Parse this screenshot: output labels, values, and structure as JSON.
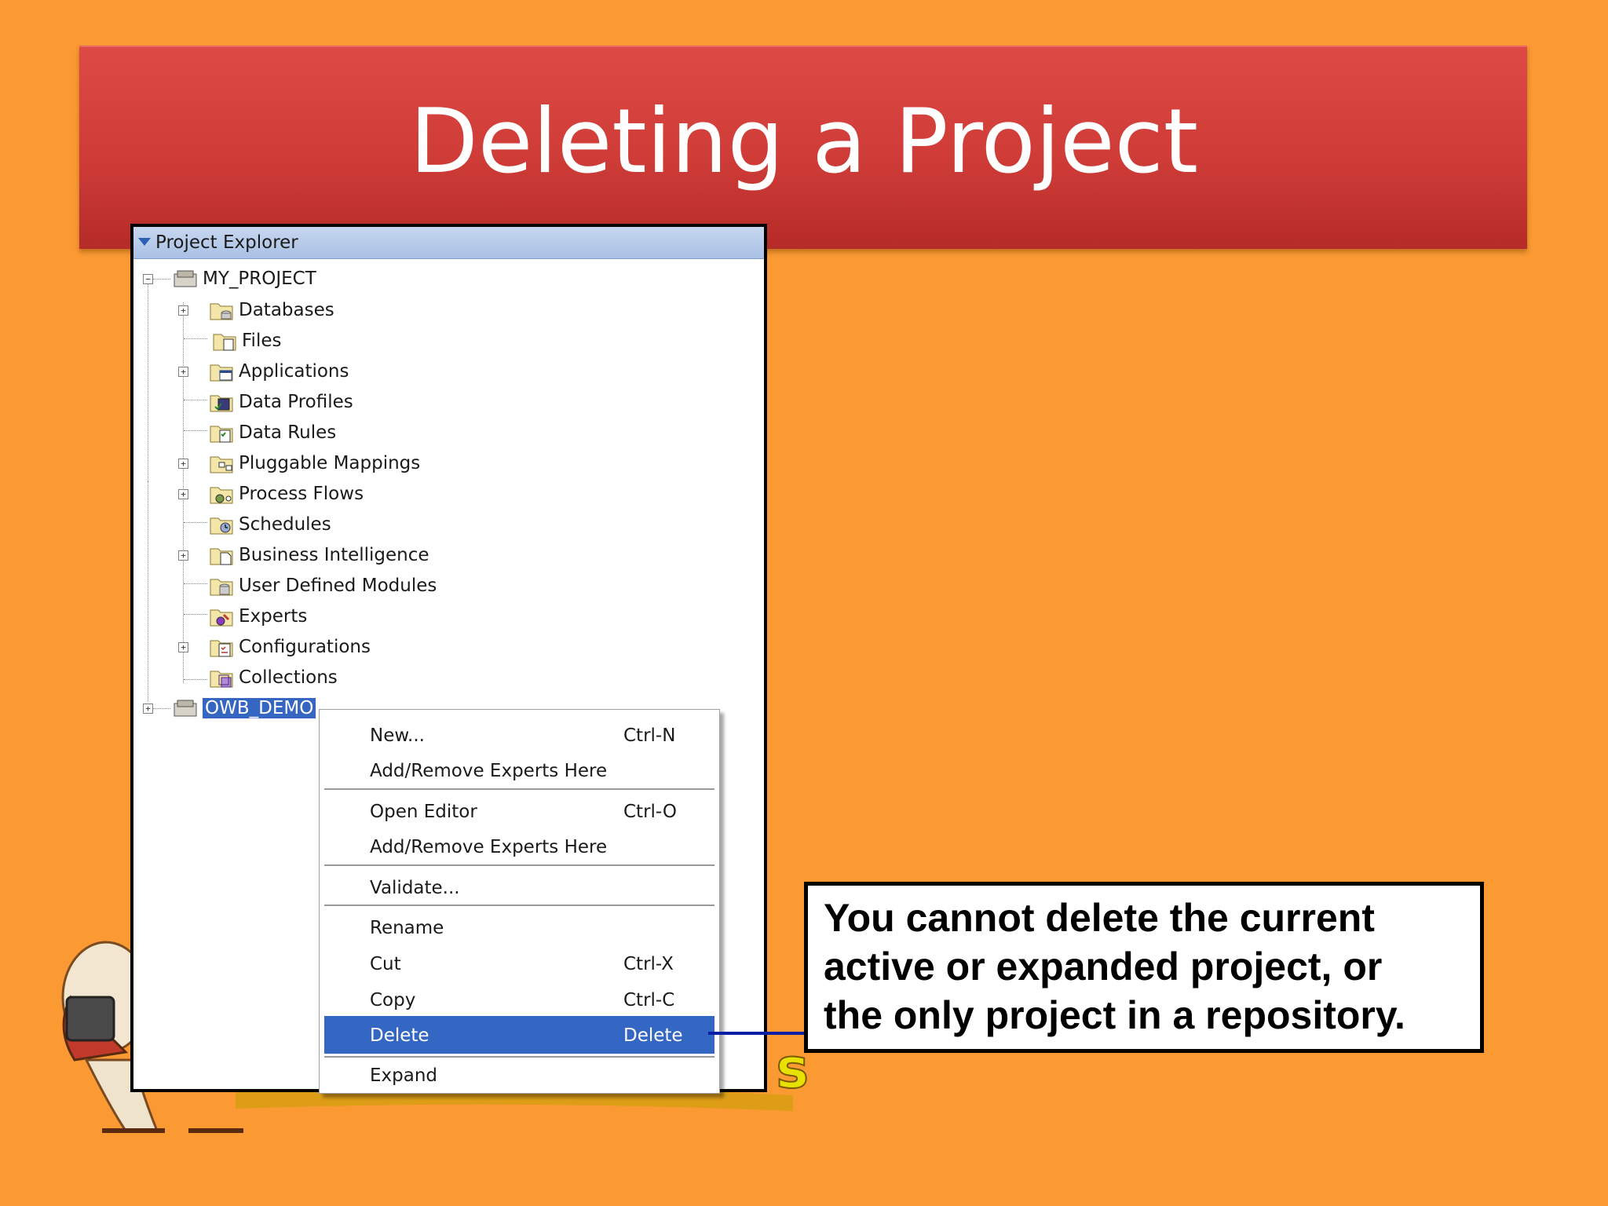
{
  "slide": {
    "title": "Deleting a Project"
  },
  "explorer": {
    "title": "Project Explorer",
    "project": "MY_PROJECT",
    "folders": [
      "Databases",
      "Files",
      "Applications",
      "Data Profiles",
      "Data Rules",
      "Pluggable Mappings",
      "Process Flows",
      "Schedules",
      "Business Intelligence",
      "User Defined Modules",
      "Experts",
      "Configurations",
      "Collections"
    ],
    "selected_project": "OWB_DEMO"
  },
  "menu": {
    "items": [
      {
        "label": "New...",
        "shortcut": "Ctrl-N"
      },
      {
        "label": "Add/Remove Experts Here",
        "shortcut": ""
      },
      {
        "label": "Open Editor",
        "shortcut": "Ctrl-O"
      },
      {
        "label": "Add/Remove Experts Here",
        "shortcut": ""
      },
      {
        "label": "Validate...",
        "shortcut": ""
      },
      {
        "label": "Rename",
        "shortcut": ""
      },
      {
        "label": "Cut",
        "shortcut": "Ctrl-X"
      },
      {
        "label": "Copy",
        "shortcut": "Ctrl-C"
      },
      {
        "label": "Delete",
        "shortcut": "Delete"
      },
      {
        "label": "Expand",
        "shortcut": ""
      }
    ]
  },
  "callout": {
    "line1": "You cannot delete the current",
    "line2": "active or expanded project, or",
    "line3": "the only project in a repository."
  },
  "colors": {
    "background": "#fb9a33",
    "banner": "#cf3c38",
    "highlight": "#3467c3",
    "connector": "#0a1ea6"
  }
}
